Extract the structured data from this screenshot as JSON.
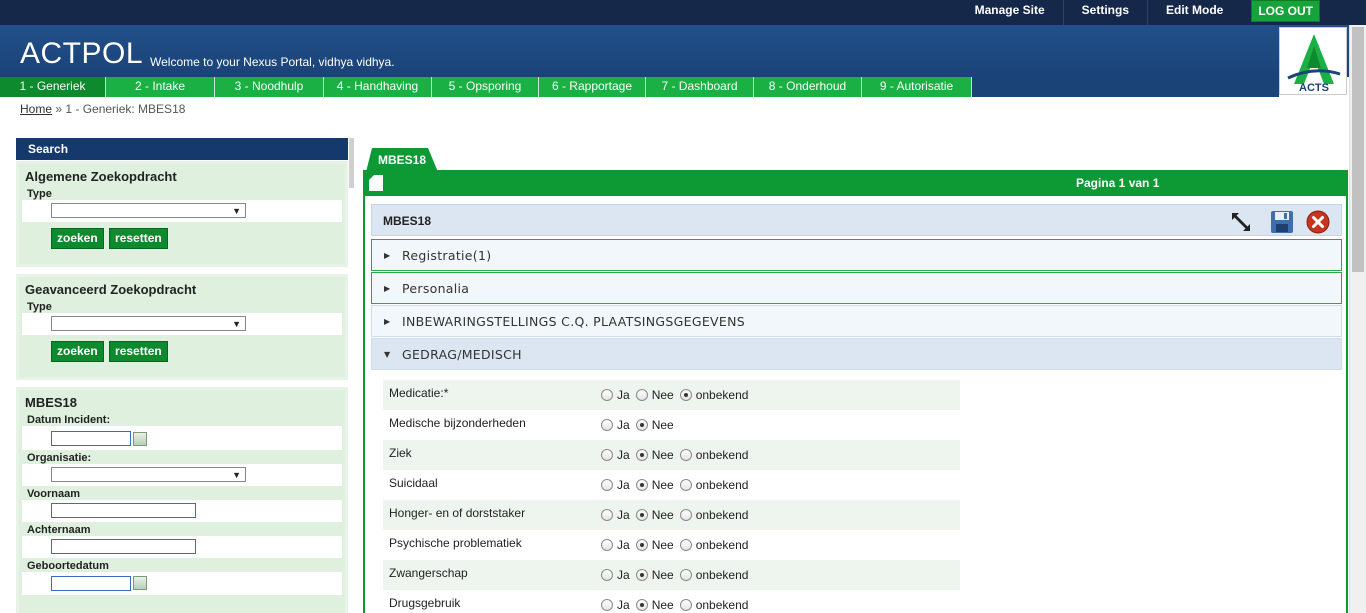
{
  "topbar": {
    "links": [
      "Manage Site",
      "Settings",
      "Edit Mode"
    ],
    "logout": "LOG OUT"
  },
  "header": {
    "brand": "ACTPOL",
    "welcome": "Welcome to your Nexus Portal, vidhya vidhya.",
    "logo_text": "ACTS"
  },
  "nav": [
    {
      "label": "1 - Generiek",
      "active": true
    },
    {
      "label": "2 - Intake"
    },
    {
      "label": "3 - Noodhulp"
    },
    {
      "label": "4 - Handhaving"
    },
    {
      "label": "5 - Opsporing"
    },
    {
      "label": "6 - Rapportage"
    },
    {
      "label": "7 - Dashboard"
    },
    {
      "label": "8 - Onderhoud"
    },
    {
      "label": "9 - Autorisatie"
    }
  ],
  "breadcrumb": {
    "home": "Home",
    "sep": " » ",
    "current": "1 - Generiek: MBES18"
  },
  "left": {
    "search_title": "Search",
    "general": {
      "title": "Algemene Zoekopdracht",
      "type_label": "Type",
      "search_btn": "zoeken",
      "reset_btn": "resetten"
    },
    "advanced": {
      "title": "Geavanceerd Zoekopdracht",
      "type_label": "Type",
      "search_btn": "zoeken",
      "reset_btn": "resetten"
    },
    "mbes": {
      "title": "MBES18",
      "date_label": "Datum Incident:",
      "org_label": "Organisatie:",
      "first_label": "Voornaam",
      "last_label": "Achternaam",
      "dob_label": "Geboortedatum"
    }
  },
  "main": {
    "tab": "MBES18",
    "pagination": "Pagina 1 van 1",
    "form_title": "MBES18",
    "icons": [
      "expand-icon",
      "save-icon",
      "close-icon"
    ],
    "sections": [
      {
        "label": "Registratie(1)",
        "state": "collapsed"
      },
      {
        "label": "Personalia",
        "state": "collapsed"
      },
      {
        "label": "INBEWARINGSTELLINGS C.Q. PLAATSINGSGEGEVENS",
        "state": "collapsed"
      },
      {
        "label": "GEDRAG/MEDISCH",
        "state": "expanded"
      }
    ],
    "options": {
      "yes": "Ja",
      "no": "Nee",
      "unknown": "onbekend"
    },
    "questions": [
      {
        "label": "Medicatie:*",
        "selected": "unknown",
        "has_unknown": true
      },
      {
        "label": "Medische bijzonderheden",
        "selected": "no",
        "has_unknown": false
      },
      {
        "label": "Ziek",
        "selected": "no",
        "has_unknown": true
      },
      {
        "label": "Suicidaal",
        "selected": "no",
        "has_unknown": true
      },
      {
        "label": "Honger- en of dorststaker",
        "selected": "no",
        "has_unknown": true
      },
      {
        "label": "Psychische problematiek",
        "selected": "no",
        "has_unknown": true
      },
      {
        "label": "Zwangerschap",
        "selected": "no",
        "has_unknown": true
      },
      {
        "label": "Drugsgebruik",
        "selected": "no",
        "has_unknown": true
      }
    ]
  },
  "colors": {
    "green": "#1bb043",
    "dark_green": "#0d8a2e",
    "navy": "#15284a",
    "blue": "#1a4378"
  }
}
